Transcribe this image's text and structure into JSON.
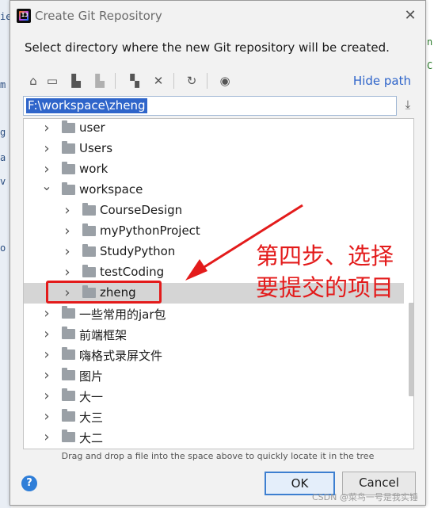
{
  "window": {
    "title": "Create Git Repository",
    "close_glyph": "✕"
  },
  "instruction": "Select directory where the new Git repository will be created.",
  "toolbar": {
    "icons": [
      "home-icon",
      "desktop-icon",
      "project-folder-icon",
      "module-folder-icon",
      "new-folder-icon",
      "delete-icon",
      "refresh-icon",
      "show-hidden-icon"
    ],
    "hide_path_label": "Hide path"
  },
  "path": {
    "value": "F:\\workspace\\zheng"
  },
  "tree": {
    "rows": [
      {
        "label": "user",
        "level": 1,
        "expanded": false,
        "selected": false
      },
      {
        "label": "Users",
        "level": 1,
        "expanded": false,
        "selected": false
      },
      {
        "label": "work",
        "level": 1,
        "expanded": false,
        "selected": false
      },
      {
        "label": "workspace",
        "level": 1,
        "expanded": true,
        "selected": false
      },
      {
        "label": "CourseDesign",
        "level": 2,
        "expanded": false,
        "selected": false
      },
      {
        "label": "myPythonProject",
        "level": 2,
        "expanded": false,
        "selected": false
      },
      {
        "label": "StudyPython",
        "level": 2,
        "expanded": false,
        "selected": false
      },
      {
        "label": "testCoding",
        "level": 2,
        "expanded": false,
        "selected": false
      },
      {
        "label": "zheng",
        "level": 2,
        "expanded": false,
        "selected": true
      },
      {
        "label": "一些常用的jar包",
        "level": 1,
        "expanded": false,
        "selected": false
      },
      {
        "label": "前端框架",
        "level": 1,
        "expanded": false,
        "selected": false
      },
      {
        "label": "嗨格式录屏文件",
        "level": 1,
        "expanded": false,
        "selected": false
      },
      {
        "label": "图片",
        "level": 1,
        "expanded": false,
        "selected": false
      },
      {
        "label": "大一",
        "level": 1,
        "expanded": false,
        "selected": false
      },
      {
        "label": "大三",
        "level": 1,
        "expanded": false,
        "selected": false
      },
      {
        "label": "大二",
        "level": 1,
        "expanded": false,
        "selected": false
      }
    ]
  },
  "hint": "Drag and drop a file into the space above to quickly locate it in the tree",
  "buttons": {
    "help": "?",
    "ok": "OK",
    "cancel": "Cancel"
  },
  "annotation": {
    "line1": "第四步、选择",
    "line2": "要提交的项目",
    "color": "#e31b1b"
  },
  "watermark": "CSDN @菜鸟一号是我实锤"
}
